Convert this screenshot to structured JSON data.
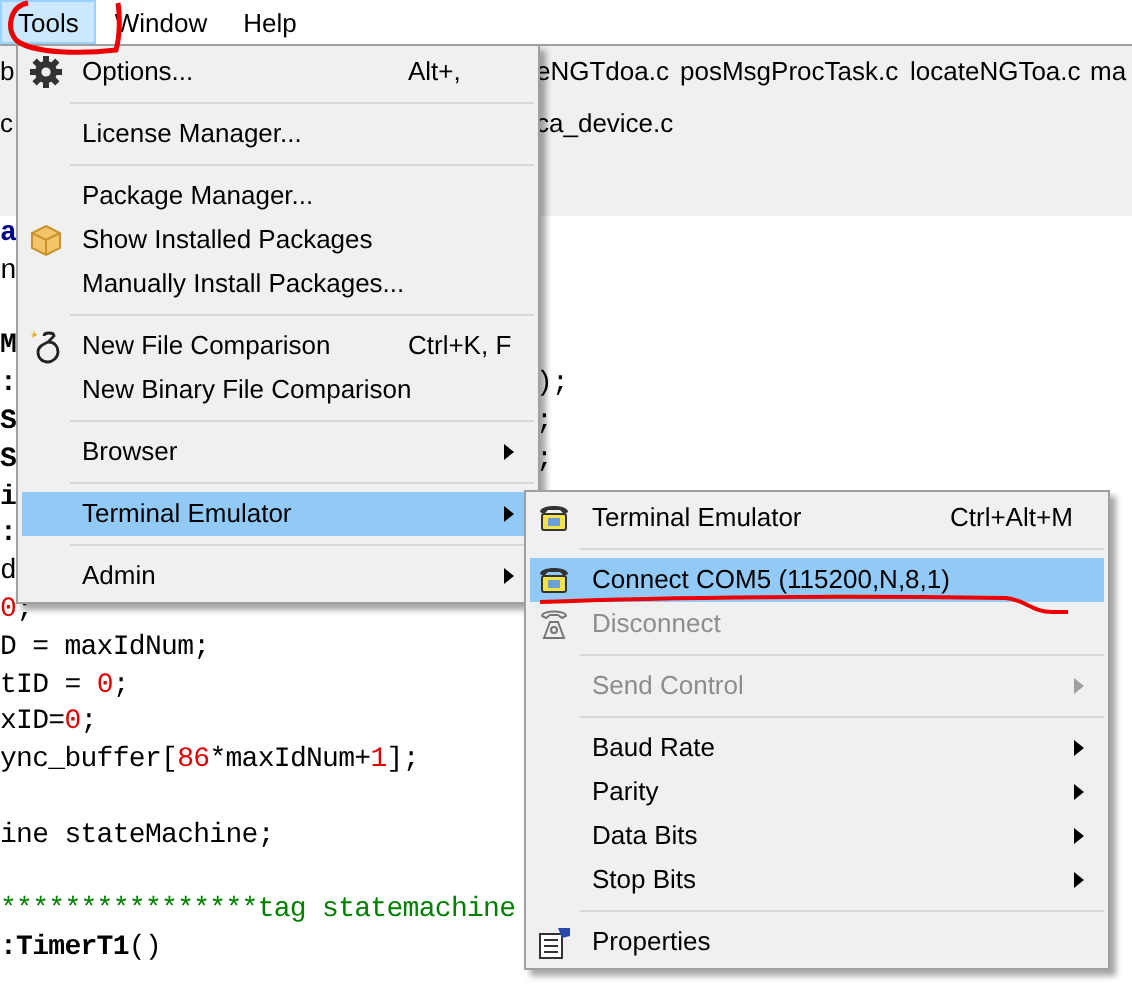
{
  "menubar": [
    {
      "label": "Tools",
      "selected": true
    },
    {
      "label": "Window",
      "selected": false
    },
    {
      "label": "Help",
      "selected": false
    }
  ],
  "file_tabs": {
    "row_1": [
      "b",
      "eNGTdoa.c",
      "posMsgProcTask.c",
      "locateNGToa.c",
      "ma"
    ],
    "row_2": [
      "c",
      "ca_device.c"
    ]
  },
  "code_lines": [
    {
      "kind": "code",
      "segments": [
        {
          "text": "a",
          "kind": "keyword"
        }
      ]
    },
    {
      "kind": "code",
      "segments": [
        {
          "text": "n",
          "kind": "plain"
        }
      ]
    },
    {
      "kind": "blank"
    },
    {
      "kind": "code",
      "segments": [
        {
          "text": "M",
          "kind": "bold"
        }
      ]
    },
    {
      "kind": "code",
      "segments": [
        {
          "text": ":",
          "kind": "bold"
        }
      ],
      "right": ");"
    },
    {
      "kind": "code",
      "segments": [
        {
          "text": "S",
          "kind": "bold"
        }
      ],
      "right": ";"
    },
    {
      "kind": "code",
      "segments": [
        {
          "text": "S",
          "kind": "bold"
        }
      ],
      "right": ";"
    },
    {
      "kind": "code",
      "segments": [
        {
          "text": "i",
          "kind": "bold"
        }
      ]
    },
    {
      "kind": "code",
      "segments": [
        {
          "text": ":",
          "kind": "bold"
        }
      ]
    },
    {
      "kind": "code",
      "segments": [
        {
          "text": "d",
          "kind": "plain"
        }
      ]
    },
    {
      "kind": "code",
      "segments": [
        {
          "text": "0",
          "kind": "number"
        },
        {
          "text": ";",
          "kind": "plain"
        }
      ]
    },
    {
      "kind": "code",
      "segments": [
        {
          "text": "D = maxIdNum;",
          "kind": "plain"
        }
      ]
    },
    {
      "kind": "code",
      "segments": [
        {
          "text": "tID = ",
          "kind": "plain"
        },
        {
          "text": "0",
          "kind": "number"
        },
        {
          "text": ";",
          "kind": "plain"
        }
      ]
    },
    {
      "kind": "code",
      "segments": [
        {
          "text": "xID=",
          "kind": "plain"
        },
        {
          "text": "0",
          "kind": "number"
        },
        {
          "text": ";",
          "kind": "plain"
        }
      ]
    },
    {
      "kind": "code",
      "segments": [
        {
          "text": "ync_buffer[",
          "kind": "plain"
        },
        {
          "text": "86",
          "kind": "number"
        },
        {
          "text": "*maxIdNum+",
          "kind": "plain"
        },
        {
          "text": "1",
          "kind": "number"
        },
        {
          "text": "];",
          "kind": "plain"
        }
      ]
    },
    {
      "kind": "blank"
    },
    {
      "kind": "code",
      "segments": [
        {
          "text": "ine stateMachine;",
          "kind": "plain"
        }
      ]
    },
    {
      "kind": "blank"
    },
    {
      "kind": "code",
      "segments": [
        {
          "text": "****************tag statemachine",
          "kind": "comment"
        }
      ]
    },
    {
      "kind": "code",
      "segments": [
        {
          "text": ":TimerT1",
          "kind": "bold"
        },
        {
          "text": "()",
          "kind": "plain"
        }
      ]
    }
  ],
  "tools_menu": [
    {
      "kind": "item",
      "label": "Options...",
      "shortcut": "Alt+,",
      "selected": false,
      "submenu": false
    },
    {
      "kind": "separator"
    },
    {
      "kind": "item",
      "label": "License Manager...",
      "selected": false,
      "submenu": false
    },
    {
      "kind": "separator"
    },
    {
      "kind": "item",
      "label": "Package Manager...",
      "selected": false,
      "submenu": false
    },
    {
      "kind": "item",
      "label": "Show Installed Packages",
      "selected": false,
      "submenu": false
    },
    {
      "kind": "item",
      "label": "Manually Install Packages...",
      "selected": false,
      "submenu": false
    },
    {
      "kind": "separator"
    },
    {
      "kind": "item",
      "label": "New File Comparison",
      "shortcut": "Ctrl+K, F",
      "selected": false,
      "submenu": false
    },
    {
      "kind": "item",
      "label": "New Binary File Comparison",
      "selected": false,
      "submenu": false
    },
    {
      "kind": "separator"
    },
    {
      "kind": "item",
      "label": "Browser",
      "selected": false,
      "submenu": true
    },
    {
      "kind": "separator"
    },
    {
      "kind": "item",
      "label": "Terminal Emulator",
      "selected": true,
      "submenu": true
    },
    {
      "kind": "separator"
    },
    {
      "kind": "item",
      "label": "Admin",
      "selected": false,
      "submenu": true
    }
  ],
  "terminal_submenu": [
    {
      "kind": "item",
      "label": "Terminal Emulator",
      "shortcut": "Ctrl+Alt+M",
      "selected": false,
      "disabled": false,
      "submenu": false
    },
    {
      "kind": "separator"
    },
    {
      "kind": "item",
      "label": "Connect COM5 (115200,N,8,1)",
      "selected": true,
      "disabled": false,
      "submenu": false
    },
    {
      "kind": "item",
      "label": "Disconnect",
      "selected": false,
      "disabled": true,
      "submenu": false
    },
    {
      "kind": "separator"
    },
    {
      "kind": "item",
      "label": "Send Control",
      "selected": false,
      "disabled": true,
      "submenu": true
    },
    {
      "kind": "separator"
    },
    {
      "kind": "item",
      "label": "Baud Rate",
      "selected": false,
      "disabled": false,
      "submenu": true
    },
    {
      "kind": "item",
      "label": "Parity",
      "selected": false,
      "disabled": false,
      "submenu": true
    },
    {
      "kind": "item",
      "label": "Data Bits",
      "selected": false,
      "disabled": false,
      "submenu": true
    },
    {
      "kind": "item",
      "label": "Stop Bits",
      "selected": false,
      "disabled": false,
      "submenu": true
    },
    {
      "kind": "separator"
    },
    {
      "kind": "item",
      "label": "Properties",
      "selected": false,
      "disabled": false,
      "submenu": false
    }
  ]
}
